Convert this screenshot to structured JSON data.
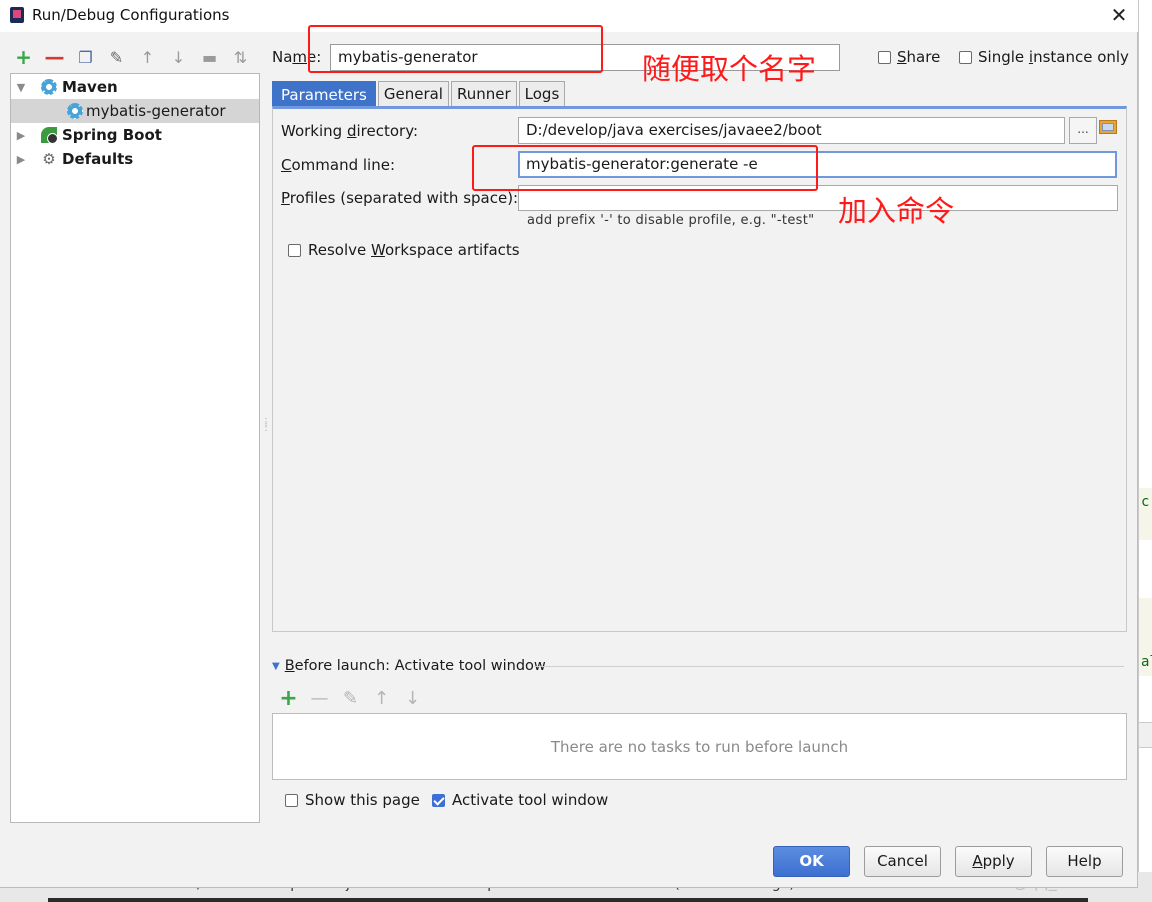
{
  "window": {
    "title": "Run/Debug Configurations",
    "close_glyph": "✕"
  },
  "toolbar": {
    "icons": [
      "add-icon",
      "remove-icon",
      "copy-icon",
      "edit-defaults-icon",
      "move-up-icon",
      "move-down-icon",
      "folder-icon",
      "sort-icon"
    ]
  },
  "tree": {
    "items": [
      {
        "label": "Maven",
        "icon": "maven-gear-icon",
        "expanded": true
      },
      {
        "label": "mybatis-generator",
        "icon": "maven-gear-icon",
        "selected": true
      },
      {
        "label": "Spring Boot",
        "icon": "spring-boot-icon",
        "expanded": false
      },
      {
        "label": "Defaults",
        "icon": "wrench-icon",
        "expanded": false
      }
    ]
  },
  "name": {
    "label_pre": "Na",
    "label_u": "m",
    "label_post": "e:",
    "value": "mybatis-generator"
  },
  "share": {
    "label_u": "S",
    "label_post": "hare",
    "checked": false
  },
  "single_instance": {
    "label_pre": "Single ",
    "label_u": "i",
    "label_post": "nstance only",
    "checked": false
  },
  "tabs": [
    {
      "label": "Parameters",
      "active": true
    },
    {
      "label": "General"
    },
    {
      "label": "Runner"
    },
    {
      "label": "Logs"
    }
  ],
  "params": {
    "working_dir": {
      "label_pre": "Working ",
      "label_u": "d",
      "label_post": "irectory:",
      "value": "D:/develop/java exercises/javaee2/boot",
      "browse_label": "..."
    },
    "command_line": {
      "label_u": "C",
      "label_post": "ommand line:",
      "value": "mybatis-generator:generate -e"
    },
    "profiles": {
      "label_u": "P",
      "label_post": "rofiles (separated with space):",
      "value": "",
      "hint": "add prefix '-' to disable profile, e.g. \"-test\""
    },
    "resolve": {
      "label_pre": "Resolve ",
      "label_u": "W",
      "label_post": "orkspace artifacts",
      "checked": false
    }
  },
  "before_launch": {
    "header_u": "B",
    "header_post": "efore launch: Activate tool window",
    "empty_text": "There are no tasks to run before launch",
    "show_page": {
      "label": "Show this page",
      "checked": false
    },
    "activate": {
      "label": "Activate tool window",
      "checked": true
    }
  },
  "buttons": {
    "ok": "OK",
    "cancel": "Cancel",
    "apply_u": "A",
    "apply_post": "pply",
    "help": "Help"
  },
  "annotations": {
    "name_note": "随便取个名字",
    "command_note": "加入命令",
    "color": "#ff1a1a"
  },
  "background": {
    "status_text": "Failed to read return header; nested exception is java.net.SocketException: Connection ... more (20 minutes ago)",
    "watermark": "CSDN @qq_42893226",
    "code1": "c,",
    "code2": "al"
  }
}
